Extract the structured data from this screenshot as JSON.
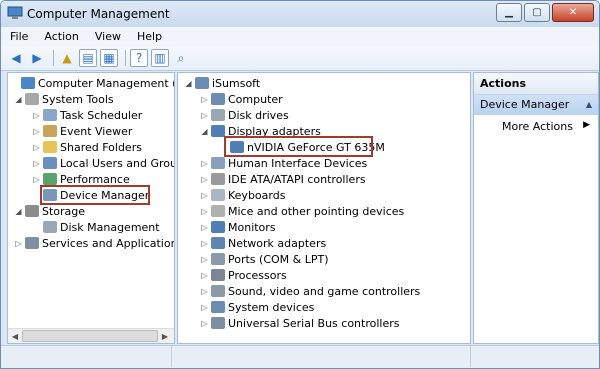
{
  "window": {
    "title": "Computer Management"
  },
  "menu": [
    "File",
    "Action",
    "View",
    "Help"
  ],
  "left_tree": {
    "root": "Computer Management (Local",
    "system_tools": "System Tools",
    "task_scheduler": "Task Scheduler",
    "event_viewer": "Event Viewer",
    "shared_folders": "Shared Folders",
    "local_users": "Local Users and Groups",
    "performance": "Performance",
    "device_manager": "Device Manager",
    "storage": "Storage",
    "disk_management": "Disk Management",
    "services": "Services and Applications"
  },
  "device_tree": {
    "root": "iSumsoft",
    "items": [
      "Computer",
      "Disk drives",
      "Display adapters",
      "nVIDIA GeForce GT 635M",
      "Human Interface Devices",
      "IDE ATA/ATAPI controllers",
      "Keyboards",
      "Mice and other pointing devices",
      "Monitors",
      "Network adapters",
      "Ports (COM & LPT)",
      "Processors",
      "Sound, video and game controllers",
      "System devices",
      "Universal Serial Bus controllers"
    ]
  },
  "actions": {
    "header": "Actions",
    "selected": "Device Manager",
    "more": "More Actions"
  },
  "colors": {
    "highlight_box": "#a33b2c",
    "selection": "#cfe1f7"
  },
  "icons": [
    "computer-icon",
    "disk-icon",
    "monitor-icon",
    "keyboard-icon",
    "mouse-icon",
    "network-icon",
    "processor-icon",
    "sound-icon",
    "usb-icon"
  ]
}
